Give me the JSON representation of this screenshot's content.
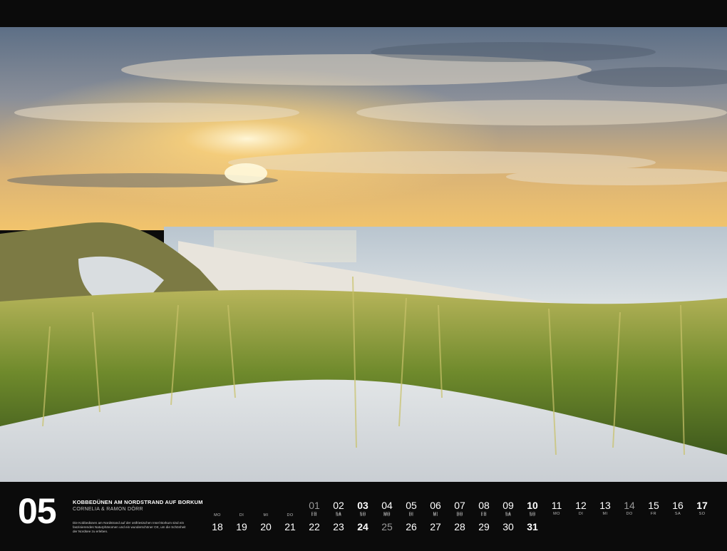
{
  "month_number": "05",
  "caption": {
    "title": "KOBBEDÜNEN AM NORDSTRAND AUF BORKUM",
    "author": "CORNELIA & RAMON DÖRR",
    "description": "Die Kobbedünen am Nordstrand auf der ostfriesischen Insel Borkum sind ein faszinierendes Naturphänomen und ein wunderschöner Ort, um die Schönheit der Nordsee zu erleben."
  },
  "calendar": {
    "row1": [
      {
        "day": "01",
        "weekday": "FR",
        "style": "dim"
      },
      {
        "day": "02",
        "weekday": "SA",
        "style": ""
      },
      {
        "day": "03",
        "weekday": "SO",
        "style": "sun"
      },
      {
        "day": "04",
        "weekday": "MO",
        "style": ""
      },
      {
        "day": "05",
        "weekday": "DI",
        "style": ""
      },
      {
        "day": "06",
        "weekday": "MI",
        "style": ""
      },
      {
        "day": "07",
        "weekday": "DO",
        "style": ""
      },
      {
        "day": "08",
        "weekday": "FR",
        "style": ""
      },
      {
        "day": "09",
        "weekday": "SA",
        "style": ""
      },
      {
        "day": "10",
        "weekday": "SO",
        "style": "sun"
      },
      {
        "day": "11",
        "weekday": "MO",
        "style": ""
      },
      {
        "day": "12",
        "weekday": "DI",
        "style": ""
      },
      {
        "day": "13",
        "weekday": "MI",
        "style": ""
      },
      {
        "day": "14",
        "weekday": "DO",
        "style": "dim"
      },
      {
        "day": "15",
        "weekday": "FR",
        "style": ""
      },
      {
        "day": "16",
        "weekday": "SA",
        "style": ""
      },
      {
        "day": "17",
        "weekday": "SO",
        "style": "sun"
      }
    ],
    "row2": [
      {
        "day": "MO",
        "weekday": "",
        "style": "wdonly"
      },
      {
        "day": "DI",
        "weekday": "",
        "style": "wdonly"
      },
      {
        "day": "MI",
        "weekday": "",
        "style": "wdonly"
      },
      {
        "day": "DO",
        "weekday": "",
        "style": "wdonly"
      },
      {
        "day": "FR",
        "weekday": "",
        "style": "wdonly"
      },
      {
        "day": "SA",
        "weekday": "",
        "style": "wdonly"
      },
      {
        "day": "SO",
        "weekday": "",
        "style": "wdonly"
      },
      {
        "day": "MO",
        "weekday": "",
        "style": "wdonly"
      },
      {
        "day": "DI",
        "weekday": "",
        "style": "wdonly"
      },
      {
        "day": "MI",
        "weekday": "",
        "style": "wdonly"
      },
      {
        "day": "DO",
        "weekday": "",
        "style": "wdonly"
      },
      {
        "day": "FR",
        "weekday": "",
        "style": "wdonly"
      },
      {
        "day": "SA",
        "weekday": "",
        "style": "wdonly"
      },
      {
        "day": "SO",
        "weekday": "",
        "style": "wdonly"
      }
    ],
    "row3": [
      {
        "day": "18",
        "style": ""
      },
      {
        "day": "19",
        "style": ""
      },
      {
        "day": "20",
        "style": ""
      },
      {
        "day": "21",
        "style": ""
      },
      {
        "day": "22",
        "style": ""
      },
      {
        "day": "23",
        "style": ""
      },
      {
        "day": "24",
        "style": "sun"
      },
      {
        "day": "25",
        "style": "dim"
      },
      {
        "day": "26",
        "style": ""
      },
      {
        "day": "27",
        "style": ""
      },
      {
        "day": "28",
        "style": ""
      },
      {
        "day": "29",
        "style": ""
      },
      {
        "day": "30",
        "style": ""
      },
      {
        "day": "31",
        "style": "sun"
      }
    ]
  }
}
